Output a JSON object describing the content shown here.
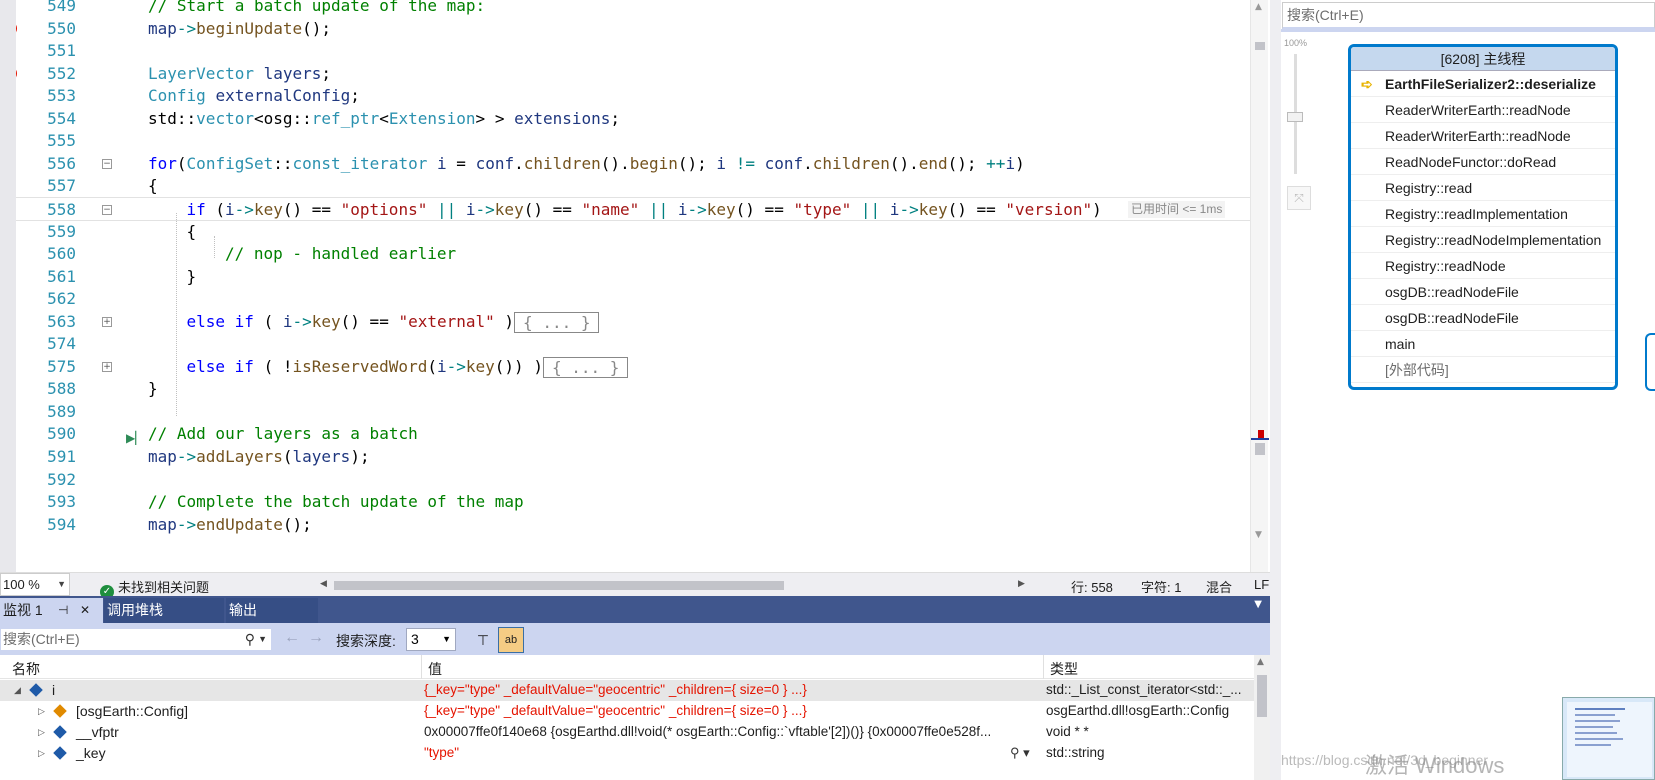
{
  "editor": {
    "lines": [
      {
        "num": "549",
        "segs": [
          [
            "c-com",
            "// Start a batch update of the map:"
          ]
        ],
        "indent": 0
      },
      {
        "num": "550",
        "bp": true,
        "segs": [
          [
            "c-var",
            "map"
          ],
          [
            "c-op",
            "->"
          ],
          [
            "c-fn",
            "beginUpdate"
          ],
          [
            "",
            "();"
          ]
        ],
        "indent": 0
      },
      {
        "num": "551",
        "segs": [],
        "indent": 0
      },
      {
        "num": "552",
        "bp": true,
        "segs": [
          [
            "c-typ",
            "LayerVector"
          ],
          [
            "",
            " "
          ],
          [
            "c-var",
            "layers"
          ],
          [
            "",
            ";"
          ]
        ],
        "indent": 0
      },
      {
        "num": "553",
        "segs": [
          [
            "c-typ",
            "Config"
          ],
          [
            "",
            " "
          ],
          [
            "c-var",
            "externalConfig"
          ],
          [
            "",
            ";"
          ]
        ],
        "indent": 0
      },
      {
        "num": "554",
        "segs": [
          [
            "",
            "std::"
          ],
          [
            "c-typ",
            "vector"
          ],
          [
            "",
            "<osg::"
          ],
          [
            "c-typ",
            "ref_ptr"
          ],
          [
            "",
            "<"
          ],
          [
            "c-typ",
            "Extension"
          ],
          [
            "",
            "> > "
          ],
          [
            "c-var",
            "extensions"
          ],
          [
            "",
            ";"
          ]
        ],
        "indent": 0
      },
      {
        "num": "555",
        "segs": [],
        "indent": 0
      },
      {
        "num": "556",
        "fold": "−",
        "segs": [
          [
            "c-kw",
            "for"
          ],
          [
            "",
            "("
          ],
          [
            "c-typ",
            "ConfigSet"
          ],
          [
            "",
            "::"
          ],
          [
            "c-typ",
            "const_iterator"
          ],
          [
            "",
            " "
          ],
          [
            "c-var",
            "i"
          ],
          [
            "",
            " = "
          ],
          [
            "c-var",
            "conf"
          ],
          [
            "",
            "."
          ],
          [
            "c-fn",
            "children"
          ],
          [
            "",
            "()."
          ],
          [
            "c-fn",
            "begin"
          ],
          [
            "",
            "(); "
          ],
          [
            "c-var",
            "i"
          ],
          [
            "",
            " "
          ],
          [
            "c-op",
            "!="
          ],
          [
            "",
            " "
          ],
          [
            "c-var",
            "conf"
          ],
          [
            "",
            "."
          ],
          [
            "c-fn",
            "children"
          ],
          [
            "",
            "()."
          ],
          [
            "c-fn",
            "end"
          ],
          [
            "",
            "(); "
          ],
          [
            "c-op",
            "++"
          ],
          [
            "c-var",
            "i"
          ],
          [
            "",
            ")"
          ]
        ],
        "indent": 0
      },
      {
        "num": "557",
        "segs": [
          [
            "",
            "{"
          ]
        ],
        "indent": 0
      },
      {
        "num": "558",
        "current": true,
        "fold": "−",
        "segs": [
          [
            "c-kw",
            "if"
          ],
          [
            "",
            " ("
          ],
          [
            "c-var",
            "i"
          ],
          [
            "c-op",
            "->"
          ],
          [
            "c-fn",
            "key"
          ],
          [
            "",
            "() == "
          ],
          [
            "c-str",
            "\"options\""
          ],
          [
            "",
            " "
          ],
          [
            "c-op",
            "||"
          ],
          [
            "",
            " "
          ],
          [
            "c-var",
            "i"
          ],
          [
            "c-op",
            "->"
          ],
          [
            "c-fn",
            "key"
          ],
          [
            "",
            "() == "
          ],
          [
            "c-str",
            "\"name\""
          ],
          [
            "",
            " "
          ],
          [
            "c-op",
            "||"
          ],
          [
            "",
            " "
          ],
          [
            "c-var",
            "i"
          ],
          [
            "c-op",
            "->"
          ],
          [
            "c-fn",
            "key"
          ],
          [
            "",
            "() == "
          ],
          [
            "c-str",
            "\"type\""
          ],
          [
            "",
            " "
          ],
          [
            "c-op",
            "||"
          ],
          [
            "",
            " "
          ],
          [
            "c-var",
            "i"
          ],
          [
            "c-op",
            "->"
          ],
          [
            "c-fn",
            "key"
          ],
          [
            "",
            "() == "
          ],
          [
            "c-str",
            "\"version\""
          ],
          [
            "",
            ")"
          ]
        ],
        "indent": 1
      },
      {
        "num": "559",
        "segs": [
          [
            "",
            "{"
          ]
        ],
        "indent": 1
      },
      {
        "num": "560",
        "segs": [
          [
            "c-com",
            "// nop - handled earlier"
          ]
        ],
        "indent": 2
      },
      {
        "num": "561",
        "segs": [
          [
            "",
            "}"
          ]
        ],
        "indent": 1
      },
      {
        "num": "562",
        "segs": [],
        "indent": 0
      },
      {
        "num": "563",
        "fold": "+",
        "segs": [
          [
            "c-kw",
            "else if"
          ],
          [
            "",
            " ( "
          ],
          [
            "c-var",
            "i"
          ],
          [
            "c-op",
            "->"
          ],
          [
            "c-fn",
            "key"
          ],
          [
            "",
            "() == "
          ],
          [
            "c-str",
            "\"external\""
          ],
          [
            "",
            " )"
          ]
        ],
        "collapsed": "{ ... }",
        "indent": 1
      },
      {
        "num": "574",
        "segs": [],
        "indent": 0
      },
      {
        "num": "575",
        "fold": "+",
        "segs": [
          [
            "c-kw",
            "else if"
          ],
          [
            "",
            " ( !"
          ],
          [
            "c-fn",
            "isReservedWord"
          ],
          [
            "",
            "("
          ],
          [
            "c-var",
            "i"
          ],
          [
            "c-op",
            "->"
          ],
          [
            "c-fn",
            "key"
          ],
          [
            "",
            "()) )"
          ]
        ],
        "collapsed": "{ ... }",
        "indent": 1
      },
      {
        "num": "588",
        "segs": [
          [
            "",
            "}"
          ]
        ],
        "indent": 0
      },
      {
        "num": "589",
        "segs": [],
        "indent": 0
      },
      {
        "num": "590",
        "runto": true,
        "segs": [
          [
            "c-com",
            "// Add our layers as a batch"
          ]
        ],
        "indent": 0
      },
      {
        "num": "591",
        "segs": [
          [
            "c-var",
            "map"
          ],
          [
            "c-op",
            "->"
          ],
          [
            "c-fn",
            "addLayers"
          ],
          [
            "",
            "("
          ],
          [
            "c-var",
            "layers"
          ],
          [
            "",
            ");"
          ]
        ],
        "indent": 0
      },
      {
        "num": "592",
        "segs": [],
        "indent": 0
      },
      {
        "num": "593",
        "segs": [
          [
            "c-com",
            "// Complete the batch update of the map"
          ]
        ],
        "indent": 0
      },
      {
        "num": "594",
        "segs": [
          [
            "c-var",
            "map"
          ],
          [
            "c-op",
            "->"
          ],
          [
            "c-fn",
            "endUpdate"
          ],
          [
            "",
            "();"
          ]
        ],
        "indent": 0
      }
    ],
    "elapsed_hint": "已用时间 <= 1ms"
  },
  "status": {
    "zoom": "100 %",
    "issues": "未找到相关问题",
    "line": "行: 558",
    "char": "字符: 1",
    "mode": "混合",
    "eol": "LF"
  },
  "toolwindow": {
    "tabs": [
      "监视 1",
      "调用堆栈",
      "输出"
    ],
    "search_placeholder": "搜索(Ctrl+E)",
    "depth_label": "搜索深度:",
    "depth_value": "3",
    "columns": {
      "name": "名称",
      "value": "值",
      "type": "类型"
    },
    "rows": [
      {
        "name": "i",
        "value": "{_key=\"type\" _defaultValue=\"geocentric\" _children={ size=0 } ...}",
        "type": "std::_List_const_iterator<std::_...",
        "changed": true,
        "expanded": true,
        "level": 0
      },
      {
        "name": "[osgEarth::Config]",
        "value": "{_key=\"type\" _defaultValue=\"geocentric\" _children={ size=0 } ...}",
        "type": "osgEarthd.dll!osgEarth::Config",
        "changed": true,
        "level": 1
      },
      {
        "name": "__vfptr",
        "value": "0x00007ffe0f140e68 {osgEarthd.dll!void(* osgEarth::Config::`vftable'[2])()} {0x00007ffe0e528f...",
        "type": "void * *",
        "changed": false,
        "level": 1
      },
      {
        "name": "_key",
        "value": "\"type\"",
        "type": "std::string",
        "changed": true,
        "level": 1
      }
    ]
  },
  "right": {
    "search_placeholder": "搜索(Ctrl+E)",
    "zoom_label": "100%",
    "thread_title": "[6208] 主线程",
    "frames": [
      "EarthFileSerializer2::deserialize",
      "ReaderWriterEarth::readNode",
      "ReaderWriterEarth::readNode",
      "ReadNodeFunctor::doRead",
      "Registry::read",
      "Registry::readImplementation",
      "Registry::readNodeImplementation",
      "Registry::readNode",
      "osgDB::readNodeFile",
      "osgDB::readNodeFile",
      "main",
      "[外部代码]"
    ],
    "watermark_main": "激活 Windows",
    "watermark_url": "https://blog.csdn.net/3d_beginner"
  },
  "colors": {
    "accent": "#007acc",
    "breakpoint": "#e51400",
    "tabbar": "#40568d",
    "toolbar": "#ccd5f0"
  }
}
